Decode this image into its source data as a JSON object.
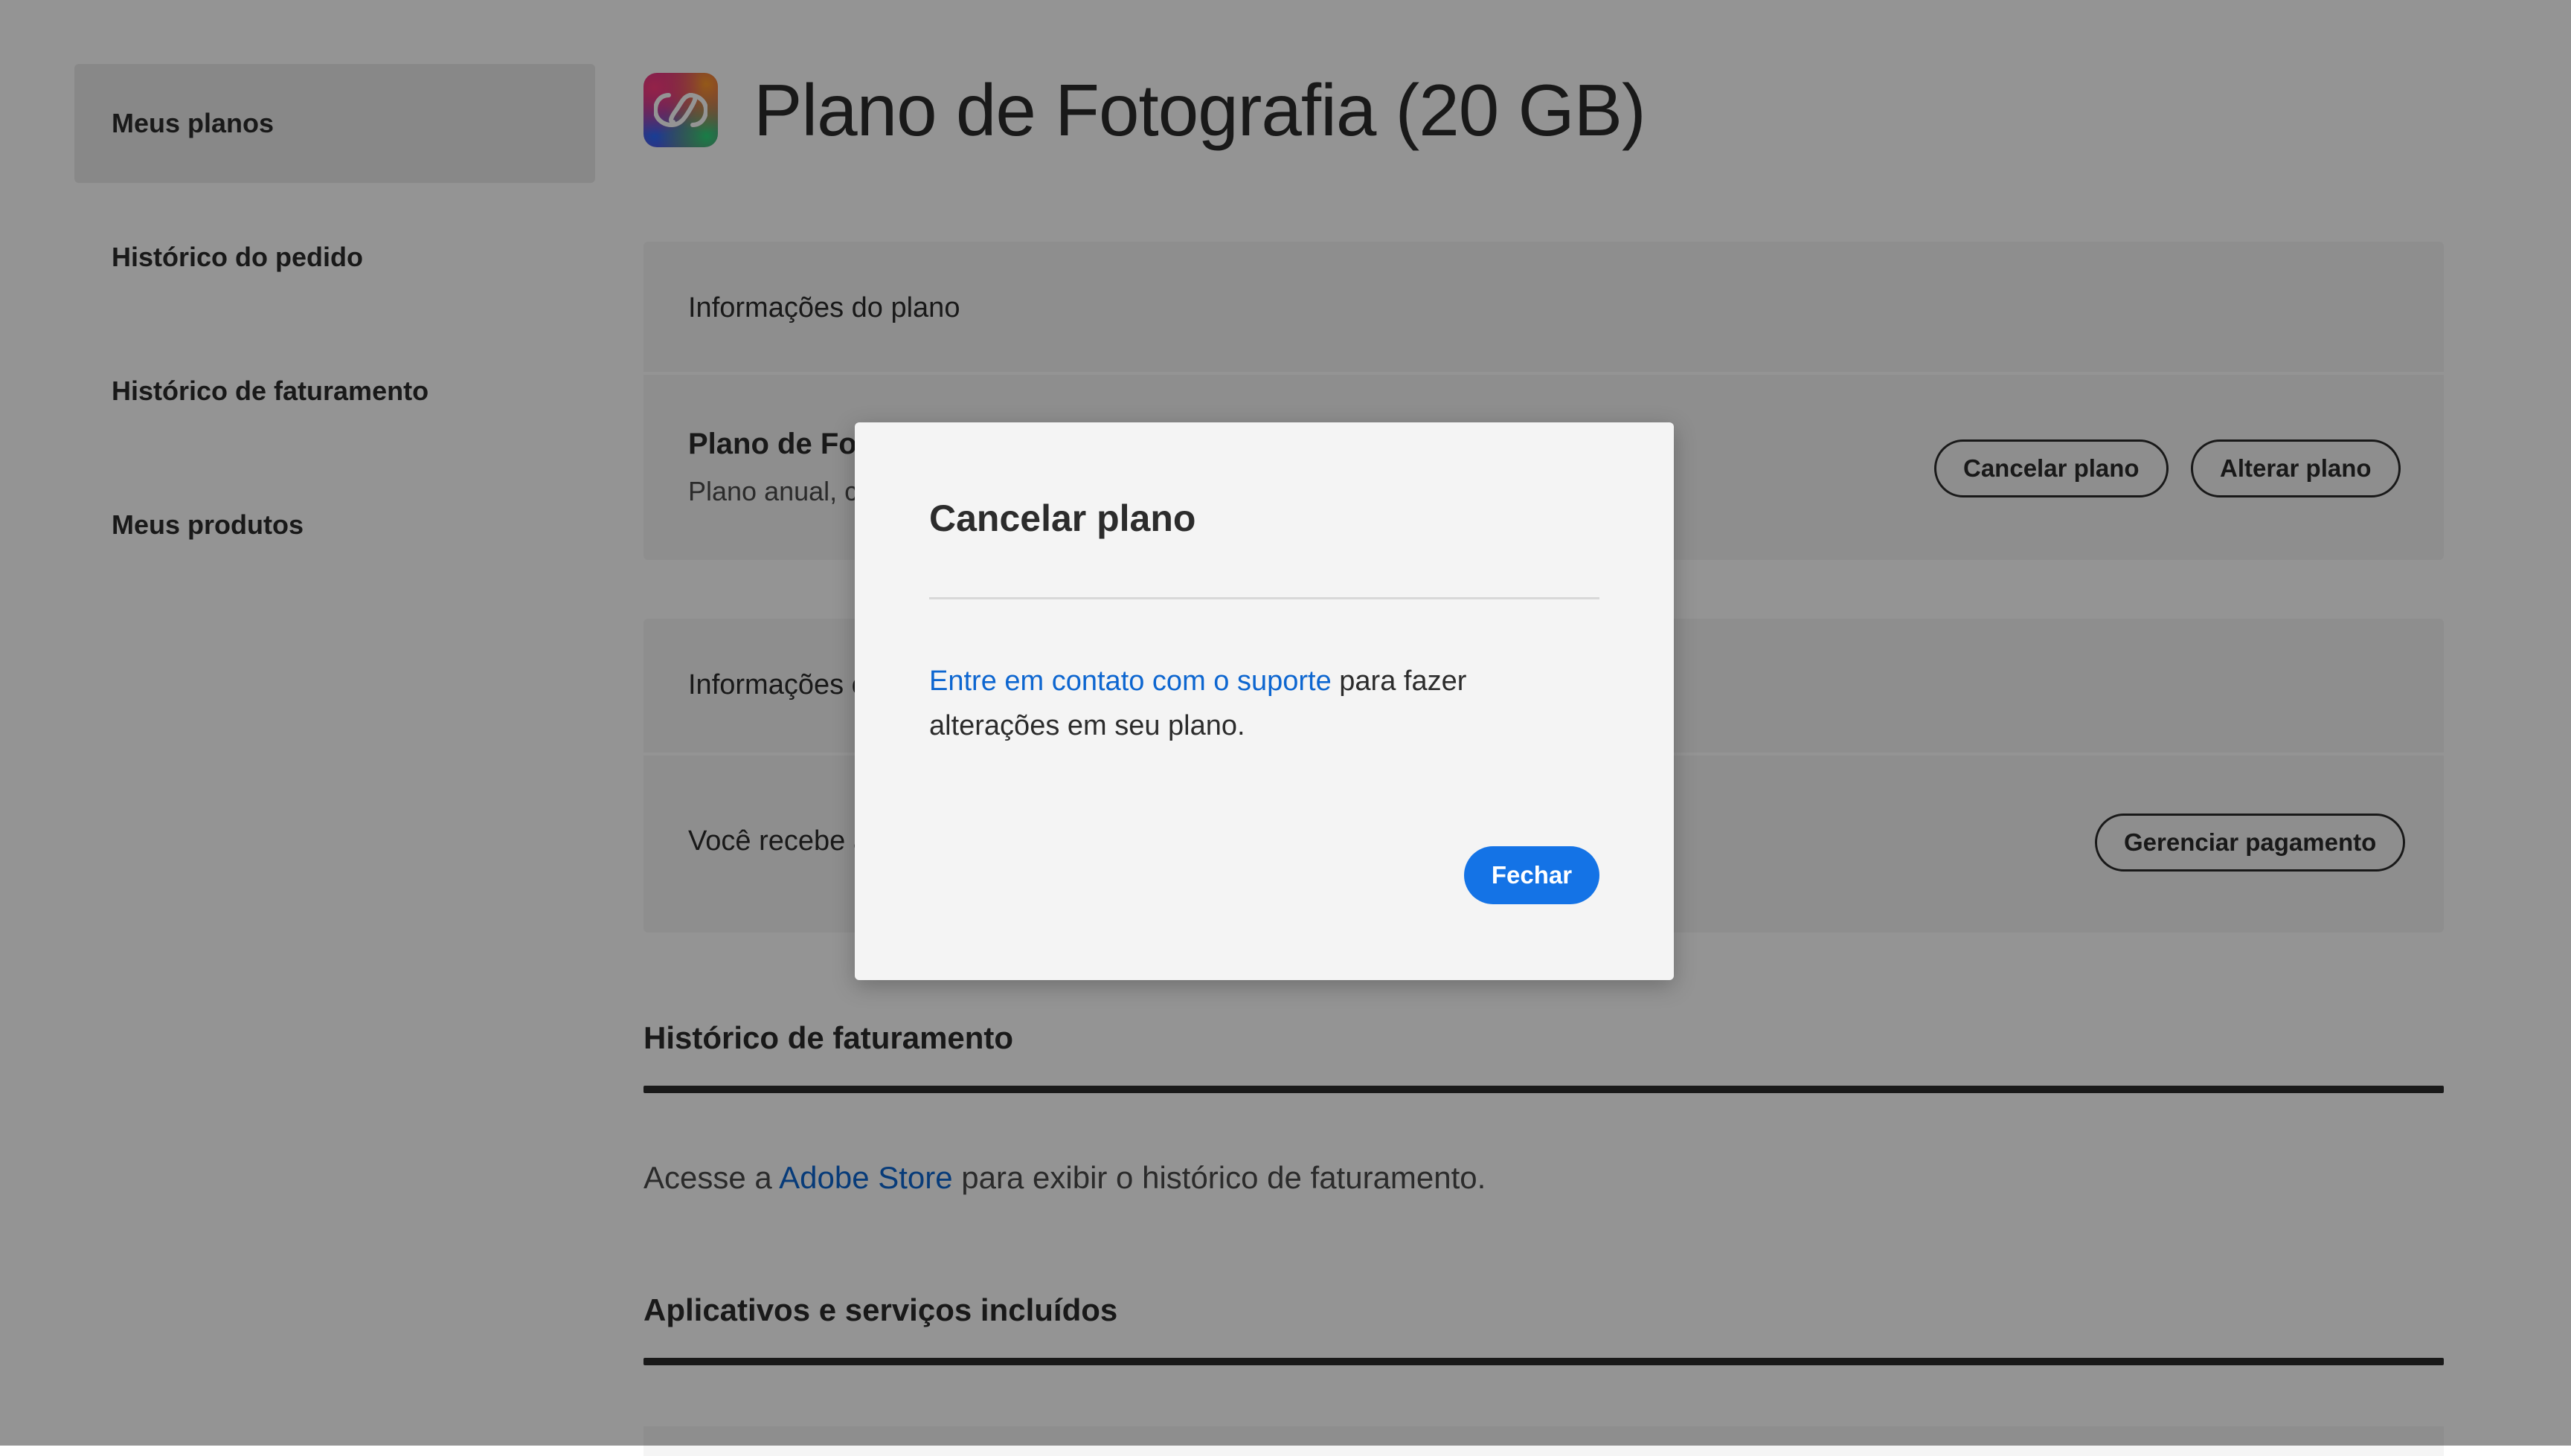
{
  "sidebar": {
    "items": [
      {
        "label": "Meus planos",
        "active": true
      },
      {
        "label": "Histórico do pedido"
      },
      {
        "label": "Histórico de faturamento"
      },
      {
        "label": "Meus produtos"
      }
    ]
  },
  "header": {
    "icon": "creative-cloud-icon",
    "title": "Plano de Fotografia (20 GB)"
  },
  "plan_card": {
    "heading": "Informações do plano",
    "plan_name": "Plano de Fo",
    "plan_sub": "Plano anual, c",
    "cancel_label": "Cancelar plano",
    "change_label": "Alterar plano"
  },
  "payment_card": {
    "heading": "Informações c",
    "text": "Você recebe a",
    "manage_label": "Gerenciar pagamento"
  },
  "billing": {
    "title": "Histórico de faturamento",
    "text_before": "Acesse a ",
    "link": "Adobe Store",
    "text_after": " para exibir o histórico de faturamento."
  },
  "apps": {
    "title": "Aplicativos e serviços incluídos"
  },
  "dialog": {
    "title": "Cancelar plano",
    "link": "Entre em contato com o suporte",
    "text": " para fazer alterações em seu plano.",
    "close_label": "Fechar"
  },
  "colors": {
    "accent": "#1473e6",
    "link": "#0d66d0",
    "overlay": "#000000"
  }
}
